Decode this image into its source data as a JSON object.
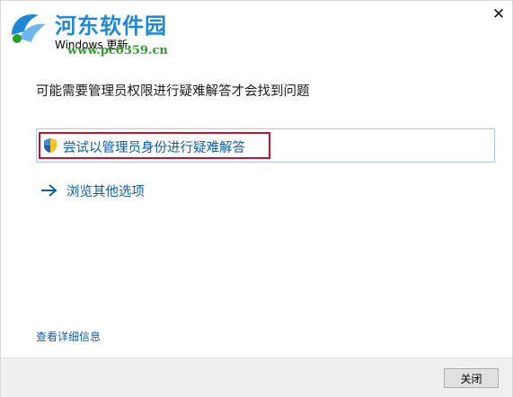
{
  "watermark": {
    "site_name": "河东软件园",
    "url": "www.pc0359.cn"
  },
  "window": {
    "title": "Windows 更新",
    "close_glyph": "✕"
  },
  "content": {
    "heading": "可能需要管理员权限进行疑难解答才会找到问题",
    "admin_option_label": "尝试以管理员身份进行疑难解答",
    "browse_option_label": "浏览其他选项",
    "details_link": "查看详细信息"
  },
  "footer": {
    "close_button_label": "关闭"
  },
  "colors": {
    "link_blue": "#0b5fa6",
    "highlight_red": "#c8102e",
    "option_border": "#a9c6e8"
  }
}
